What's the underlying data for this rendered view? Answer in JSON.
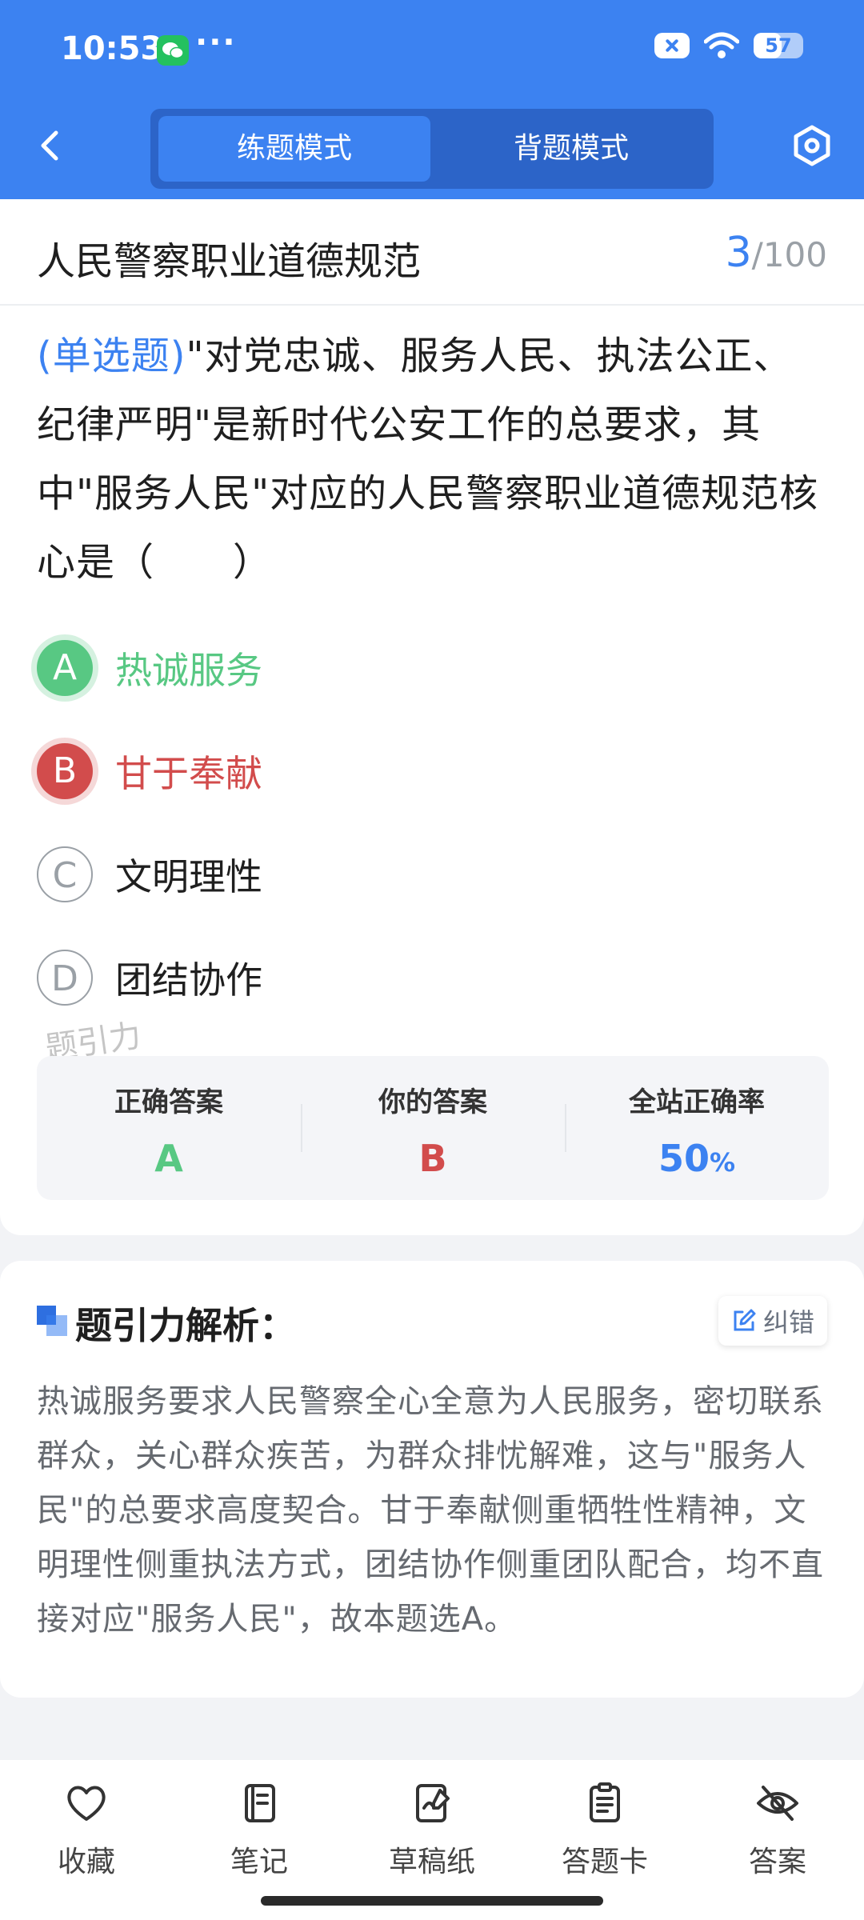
{
  "status_bar": {
    "time": "10:53",
    "dots": "···",
    "battery": "57",
    "battery_level": 0.57
  },
  "nav": {
    "modes": [
      "练题模式",
      "背题模式"
    ],
    "active_mode": 0
  },
  "header": {
    "title": "人民警察职业道德规范",
    "current": "3",
    "total": "/100"
  },
  "question": {
    "type_label": "(单选题)",
    "text": "\"对党忠诚、服务人民、执法公正、纪律严明\"是新时代公安工作的总要求，其中\"服务人民\"对应的人民警察职业道德规范核心是（　　）"
  },
  "options": [
    {
      "letter": "A",
      "text": "热诚服务",
      "state": "correct"
    },
    {
      "letter": "B",
      "text": "甘于奉献",
      "state": "wrong"
    },
    {
      "letter": "C",
      "text": "文明理性",
      "state": "normal"
    },
    {
      "letter": "D",
      "text": "团结协作",
      "state": "normal"
    }
  ],
  "watermark": "题引力",
  "stats": {
    "correct_label": "正确答案",
    "correct_value": "A",
    "yours_label": "你的答案",
    "yours_value": "B",
    "rate_label": "全站正确率",
    "rate_value": "50",
    "rate_unit": "%"
  },
  "analysis": {
    "title": "题引力解析：",
    "correction_label": "纠错",
    "text": "热诚服务要求人民警察全心全意为人民服务，密切联系群众，关心群众疾苦，为群众排忧解难，这与\"服务人民\"的总要求高度契合。甘于奉献侧重牺牲性精神，文明理性侧重执法方式，团结协作侧重团队配合，均不直接对应\"服务人民\"，故本题选A。"
  },
  "bottom_tabs": [
    {
      "label": "收藏",
      "icon": "heart-icon"
    },
    {
      "label": "笔记",
      "icon": "notebook-icon"
    },
    {
      "label": "草稿纸",
      "icon": "draft-paper-icon"
    },
    {
      "label": "答题卡",
      "icon": "answer-card-icon"
    },
    {
      "label": "答案",
      "icon": "eye-off-icon"
    }
  ],
  "colors": {
    "primary": "#3c82f1",
    "correct": "#58c883",
    "wrong": "#d24c4c"
  }
}
